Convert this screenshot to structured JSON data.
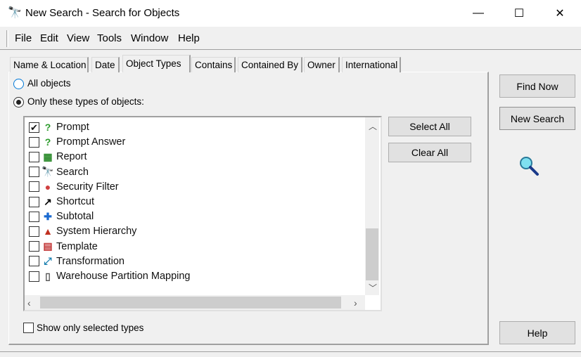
{
  "window": {
    "title": "New Search - Search for Objects",
    "minimize": "—",
    "maximize": "☐",
    "close": "✕"
  },
  "menu": [
    {
      "label": "File"
    },
    {
      "label": "Edit"
    },
    {
      "label": "View"
    },
    {
      "label": "Tools"
    },
    {
      "label": "Window"
    },
    {
      "label": "Help"
    }
  ],
  "tabs": [
    {
      "label": "Name & Location"
    },
    {
      "label": "Date"
    },
    {
      "label": "Object Types",
      "active": true
    },
    {
      "label": "Contains"
    },
    {
      "label": "Contained By"
    },
    {
      "label": "Owner"
    },
    {
      "label": "International"
    }
  ],
  "object_types": {
    "radio_all": {
      "label": "All objects",
      "selected": false
    },
    "radio_only": {
      "label": "Only these types of objects:",
      "selected": true
    },
    "items": [
      {
        "label": "Prompt",
        "checked": true,
        "icon": "prompt-icon"
      },
      {
        "label": "Prompt Answer",
        "checked": false,
        "icon": "prompt-answer-icon"
      },
      {
        "label": "Report",
        "checked": false,
        "icon": "report-icon"
      },
      {
        "label": "Search",
        "checked": false,
        "icon": "binoculars-icon"
      },
      {
        "label": "Security Filter",
        "checked": false,
        "icon": "security-filter-icon"
      },
      {
        "label": "Shortcut",
        "checked": false,
        "icon": "shortcut-icon"
      },
      {
        "label": "Subtotal",
        "checked": false,
        "icon": "subtotal-icon"
      },
      {
        "label": "System Hierarchy",
        "checked": false,
        "icon": "hierarchy-icon"
      },
      {
        "label": "Template",
        "checked": false,
        "icon": "template-icon"
      },
      {
        "label": "Transformation",
        "checked": false,
        "icon": "transformation-icon"
      },
      {
        "label": "Warehouse Partition Mapping",
        "checked": false,
        "icon": "partition-mapping-icon"
      }
    ],
    "select_all": "Select All",
    "clear_all": "Clear All",
    "show_selected": {
      "label": "Show only selected types",
      "checked": false
    }
  },
  "buttons": {
    "find_now": "Find Now",
    "new_search": "New Search",
    "help": "Help"
  }
}
